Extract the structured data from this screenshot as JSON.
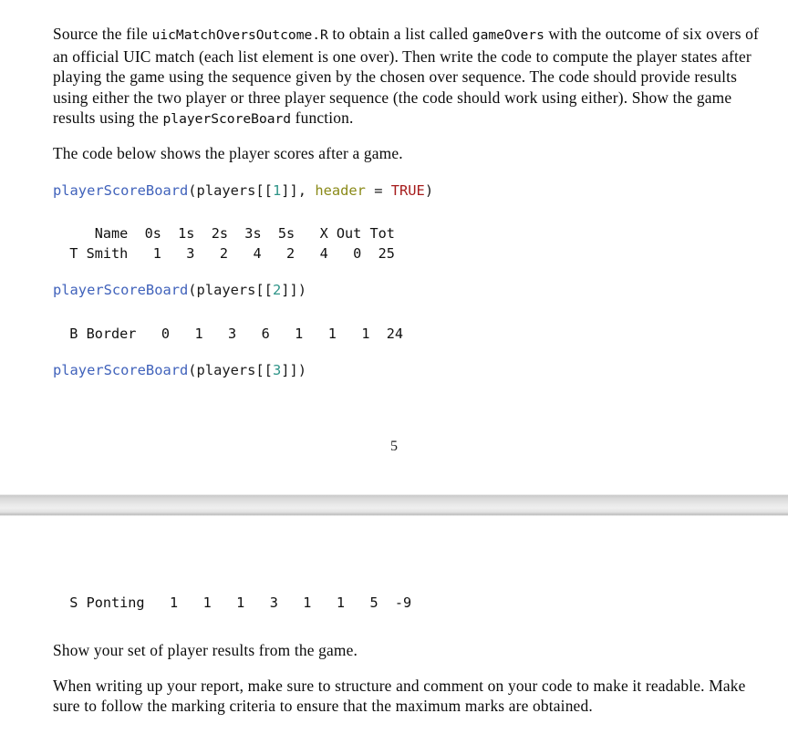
{
  "document": {
    "page_number": "5",
    "clipped_glyph": ")",
    "paragraphs": {
      "task_intro_parts": {
        "t1": "Source the file ",
        "c1": "uicMatchOversOutcome.R",
        "t2": " to obtain a list called ",
        "c2": "gameOvers",
        "t3": " with the outcome of six overs of an official UIC match (each list element is one over). Then write the code to compute the player states after playing the game using the sequence given by the chosen over sequence. The code should provide results using either the two player or three player sequence (the code should work using either). Show the game results using the ",
        "c3": "playerScoreBoard",
        "t4": " function."
      },
      "code_intro": "The code below shows the player scores after a game.",
      "show_results": "Show your set of player results from the game.",
      "report_note": "When writing up your report, make sure to structure and comment on your code to make it readable. Make sure to follow the marking criteria to ensure that the maximum marks are obtained."
    },
    "code_blocks": [
      {
        "id": "call-1",
        "fn": "playerScoreBoard",
        "open": "(",
        "var": "players[[",
        "index": "1",
        "close_idx": "]], ",
        "arg": "header",
        "eq": " = ",
        "const": "TRUE",
        "close": ")"
      },
      {
        "id": "call-2",
        "fn": "playerScoreBoard",
        "open": "(",
        "var": "players[[",
        "index": "2",
        "close_idx": "]]",
        "close": ")"
      },
      {
        "id": "call-3",
        "fn": "playerScoreBoard",
        "open": "(",
        "var": "players[[",
        "index": "3",
        "close_idx": "]]",
        "close": ")"
      }
    ],
    "console_output": {
      "scoreboard_1_header": "     Name  0s  1s  2s  3s  5s   X Out Tot",
      "scoreboard_1_row": "  T Smith   1   3   2   4   2   4   0  25",
      "scoreboard_2_row": "  B Border   0   1   3   6   1   1   1  24",
      "scoreboard_3_row": "  S Ponting   1   1   1   3   1   1   5  -9"
    },
    "scoreboards": {
      "columns": [
        "Name",
        "0s",
        "1s",
        "2s",
        "3s",
        "5s",
        "X",
        "Out",
        "Tot"
      ],
      "rows": [
        {
          "name": "T Smith",
          "zeros": "1",
          "ones": "3",
          "twos": "2",
          "threes": "4",
          "fives": "2",
          "x": "4",
          "out": "0",
          "tot": "25"
        },
        {
          "name": "B Border",
          "zeros": "0",
          "ones": "1",
          "twos": "3",
          "threes": "6",
          "fives": "1",
          "x": "1",
          "out": "1",
          "tot": "24"
        },
        {
          "name": "S Ponting",
          "zeros": "1",
          "ones": "1",
          "twos": "1",
          "threes": "3",
          "fives": "1",
          "x": "1",
          "out": "5",
          "tot": "-9"
        }
      ]
    },
    "colors": {
      "code_function": "#4062bb",
      "code_number": "#2e9488",
      "code_argument": "#8a8a19",
      "code_constant": "#a61c1c",
      "code_punct": "#1a1a1a",
      "body_text": "#0b0b0b",
      "page_break_bar": "#d9d9d9"
    }
  }
}
